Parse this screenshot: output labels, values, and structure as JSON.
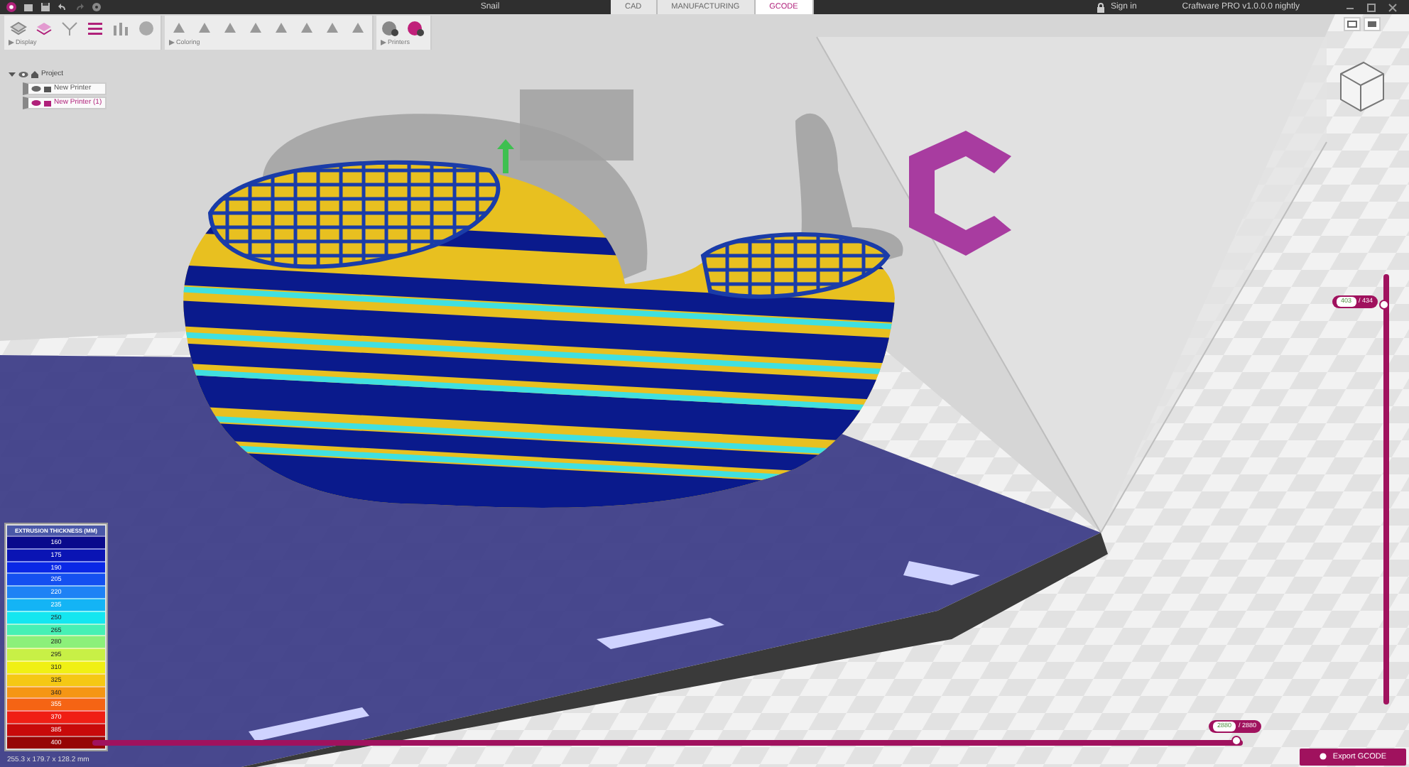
{
  "window": {
    "title": "Snail",
    "app_version": "Craftware PRO v1.0.0.0 nightly",
    "sign_in": "Sign in"
  },
  "tabs": [
    {
      "label": "CAD",
      "selected": false
    },
    {
      "label": "MANUFACTURING",
      "selected": false
    },
    {
      "label": "GCODE",
      "selected": true
    }
  ],
  "toolbar_groups": [
    {
      "label": "Display"
    },
    {
      "label": "Coloring"
    },
    {
      "label": "Printers"
    }
  ],
  "tree": {
    "label": "Project",
    "children": [
      {
        "label": "New Printer",
        "selected": false
      },
      {
        "label": "New Printer (1)",
        "selected": true
      }
    ]
  },
  "legend": {
    "title": "EXTRUSION THICKNESS (MM)",
    "items": [
      {
        "label": "160",
        "color": "#0a0a8c"
      },
      {
        "label": "175",
        "color": "#0a14b4"
      },
      {
        "label": "190",
        "color": "#0a28e6"
      },
      {
        "label": "205",
        "color": "#1450f0"
      },
      {
        "label": "220",
        "color": "#1e82f5"
      },
      {
        "label": "235",
        "color": "#14b4f5"
      },
      {
        "label": "250",
        "color": "#14e6f0"
      },
      {
        "label": "265",
        "color": "#46f0b4"
      },
      {
        "label": "280",
        "color": "#8cf07a"
      },
      {
        "label": "295",
        "color": "#c8f046"
      },
      {
        "label": "310",
        "color": "#f0f014"
      },
      {
        "label": "325",
        "color": "#f5c814"
      },
      {
        "label": "340",
        "color": "#f59614"
      },
      {
        "label": "355",
        "color": "#f56414"
      },
      {
        "label": "370",
        "color": "#f01e14"
      },
      {
        "label": "385",
        "color": "#c80a0a"
      },
      {
        "label": "400",
        "color": "#960505"
      }
    ]
  },
  "layer_slider": {
    "current": "403",
    "total": "/ 434",
    "level": 0.93
  },
  "step_slider": {
    "current": "2880",
    "total": "/ 2880",
    "level": 1.0
  },
  "status_bar": {
    "dimensions": "255.3 x 179.7 x 128.2 mm"
  },
  "export_button": {
    "label": "Export GCODE"
  }
}
